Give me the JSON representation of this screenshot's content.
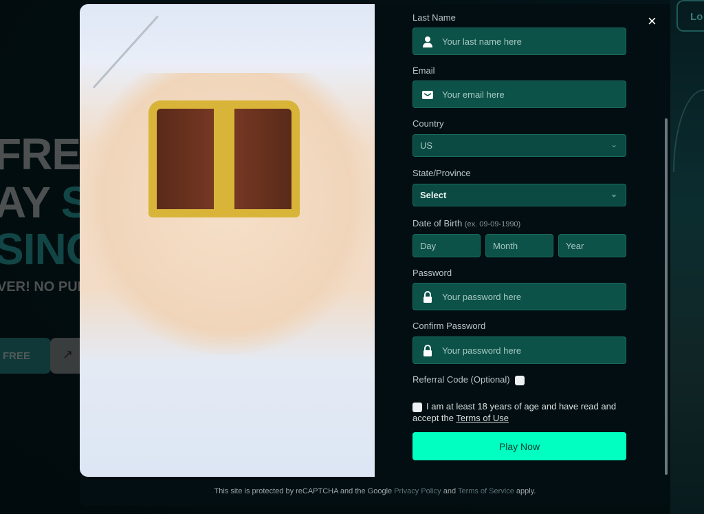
{
  "background": {
    "hero_line1": "FREE",
    "hero_line2_a": "AY ",
    "hero_line2_b": "S",
    "hero_line3": "SINC",
    "tagline": "VER! NO PUR",
    "cta_label": "FREE",
    "arrow_icon": "↗",
    "login_label": "Lo"
  },
  "modal": {
    "close_icon": "×",
    "last_name": {
      "label": "Last Name",
      "placeholder": "Your last name here"
    },
    "email": {
      "label": "Email",
      "placeholder": "Your email here"
    },
    "country": {
      "label": "Country",
      "value": "US"
    },
    "state": {
      "label": "State/Province",
      "value": "Select"
    },
    "dob": {
      "label": "Date of Birth",
      "hint": "(ex. 09-09-1990)",
      "day": "Day",
      "month": "Month",
      "year": "Year"
    },
    "password": {
      "label": "Password",
      "placeholder": "Your password here"
    },
    "confirm_password": {
      "label": "Confirm Password",
      "placeholder": "Your password here"
    },
    "referral": {
      "label": "Referral Code (Optional)"
    },
    "terms": {
      "text": "I am at least 18 years of age and have read and accept the ",
      "link": "Terms of Use"
    },
    "play_button": "Play Now",
    "footer": {
      "text1": "This site is protected by reCAPTCHA and the Google ",
      "privacy": "Privacy Policy",
      "and": " and ",
      "tos": "Terms of Service",
      "apply": " apply."
    }
  },
  "colors": {
    "accent": "#00ffc0",
    "field": "#0c5248",
    "modal": "#020e11"
  }
}
